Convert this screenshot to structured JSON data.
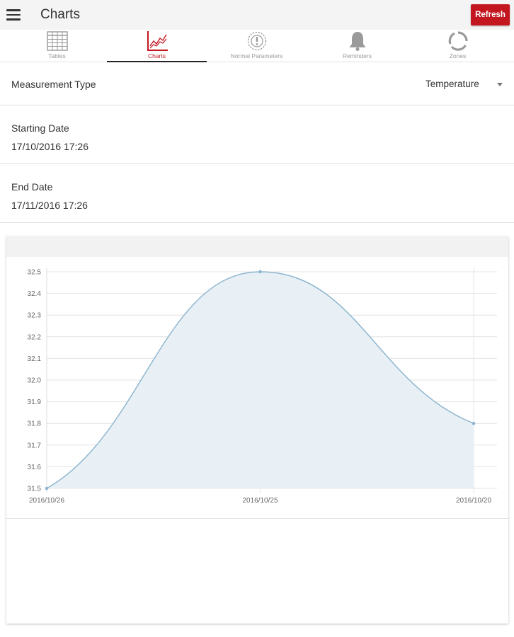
{
  "appbar": {
    "title": "Charts",
    "refresh_label": "Refresh"
  },
  "tabs": [
    {
      "label": "Tables",
      "icon": "table-icon",
      "active": false
    },
    {
      "label": "Charts",
      "icon": "line-chart-icon",
      "active": true
    },
    {
      "label": "Normal Parameters",
      "icon": "alert-circle-icon",
      "active": false
    },
    {
      "label": "Reminders",
      "icon": "bell-icon",
      "active": false
    },
    {
      "label": "Zones",
      "icon": "zones-ring-icon",
      "active": false
    }
  ],
  "form": {
    "measurement_type_label": "Measurement Type",
    "measurement_type_value": "Temperature",
    "start_label": "Starting Date",
    "start_value": "17/10/2016 17:26",
    "end_label": "End Date",
    "end_value": "17/11/2016 17:26"
  },
  "colors": {
    "accent": "#c3161f",
    "line": "#8fb6cf",
    "fill": "#e8f0f6",
    "grid": "#e4e4e4"
  },
  "chart_data": {
    "type": "area",
    "categories": [
      "2016/10/26",
      "2016/10/25",
      "2016/10/20"
    ],
    "series": [
      {
        "values": [
          31.5,
          32.5,
          31.8
        ]
      }
    ],
    "ylim": [
      31.5,
      32.5
    ],
    "yticks": [
      "31.5",
      "31.6",
      "31.7",
      "31.8",
      "31.9",
      "32.0",
      "32.1",
      "32.2",
      "32.3",
      "32.4",
      "32.5"
    ],
    "grid": true,
    "title": "",
    "xlabel": "",
    "ylabel": ""
  }
}
